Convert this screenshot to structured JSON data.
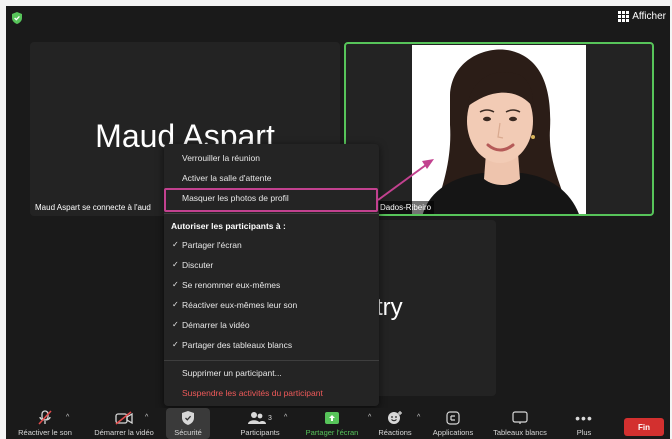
{
  "topbar": {
    "view_label": "Afficher"
  },
  "tiles": {
    "maud": {
      "name": "Maud Aspart",
      "label": "Maud Aspart se connecte à l'aud"
    },
    "dados": {
      "label": "Dados-Ribeiro"
    },
    "third": {
      "name_fragment": "try"
    }
  },
  "menu": {
    "items": [
      "Verrouiller la réunion",
      "Activer la salle d'attente",
      "Masquer les photos de profil"
    ],
    "heading": "Autoriser les participants à :",
    "permissions": [
      "Partager l'écran",
      "Discuter",
      "Se renommer eux-mêmes",
      "Réactiver eux-mêmes leur son",
      "Démarrer la vidéo",
      "Partager des tableaux blancs"
    ],
    "remove_participant": "Supprimer un participant...",
    "suspend_activities": "Suspendre les activités du participant"
  },
  "toolbar": {
    "unmute": "Réactiver le son",
    "start_video": "Démarrer la vidéo",
    "security": "Sécurité",
    "participants": "Participants",
    "participants_count": "3",
    "share_screen": "Partager l'écran",
    "reactions": "Réactions",
    "apps": "Applications",
    "whiteboards": "Tableaux blancs",
    "more": "Plus",
    "end": "Fin"
  },
  "colors": {
    "accent_green": "#57c45a",
    "highlight_pink": "#c2418f",
    "danger_red": "#ef5a5a",
    "end_red": "#d3302f"
  }
}
